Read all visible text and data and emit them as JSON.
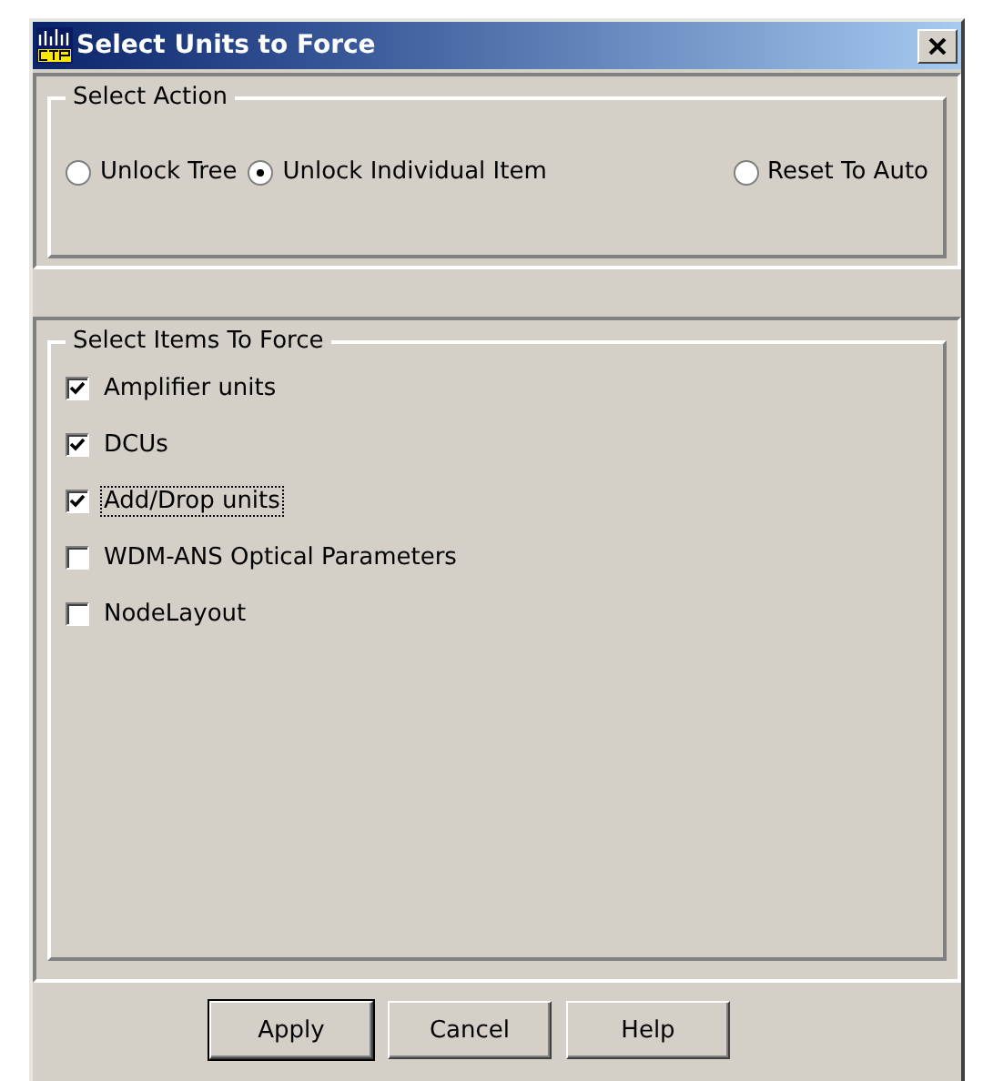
{
  "window": {
    "title": "Select Units to Force"
  },
  "action_group": {
    "title": "Select Action",
    "options": [
      {
        "label": "Unlock Tree",
        "selected": false
      },
      {
        "label": "Unlock Individual Item",
        "selected": true
      },
      {
        "label": "Reset To Auto",
        "selected": false
      }
    ]
  },
  "items_group": {
    "title": "Select Items To Force",
    "items": [
      {
        "label": "Amplifier units",
        "checked": true,
        "focused": false
      },
      {
        "label": "DCUs",
        "checked": true,
        "focused": false
      },
      {
        "label": "Add/Drop units",
        "checked": true,
        "focused": true
      },
      {
        "label": "WDM-ANS Optical Parameters",
        "checked": false,
        "focused": false
      },
      {
        "label": "NodeLayout",
        "checked": false,
        "focused": false
      }
    ]
  },
  "buttons": [
    {
      "label": "Apply",
      "default": true
    },
    {
      "label": "Cancel",
      "default": false
    },
    {
      "label": "Help",
      "default": false
    }
  ]
}
